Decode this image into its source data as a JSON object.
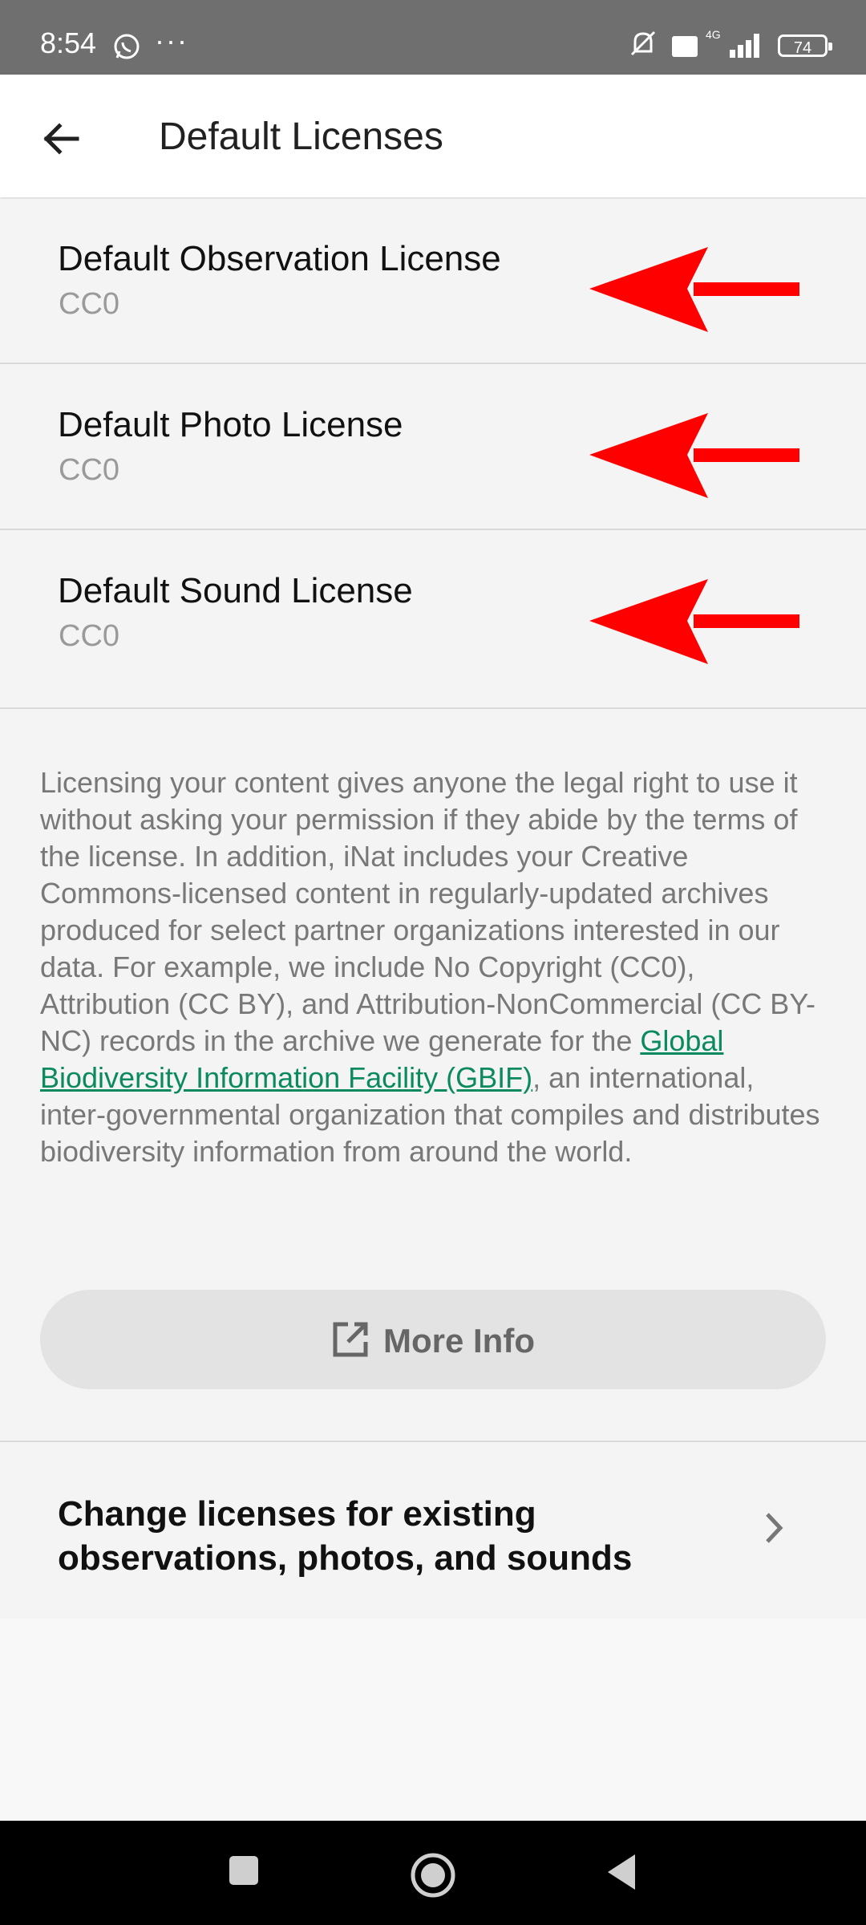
{
  "status_bar": {
    "time": "8:54",
    "dots": "···",
    "volte": "Vo LTE",
    "network": "4G",
    "battery": "74"
  },
  "app_bar": {
    "title": "Default Licenses"
  },
  "licenses": [
    {
      "title": "Default Observation License",
      "value": "CC0"
    },
    {
      "title": "Default Photo License",
      "value": "CC0"
    },
    {
      "title": "Default Sound License",
      "value": "CC0"
    }
  ],
  "info": {
    "text_before_link": "Licensing your content gives anyone the legal right to use it without asking your permission if they abide by the terms of the license. In addition, iNat includes your Creative Commons-licensed content in regularly-updated archives produced for select partner organizations interested in our data. For example, we include No Copyright (CC0), Attribution (CC BY), and Attribution-NonCommercial (CC BY-NC) records in the archive we generate for the ",
    "link_text": "Global Biodiversity Information Facility (GBIF)",
    "text_after_link": ", an international, inter-governmental organization that compiles and distributes biodiversity information from around the world."
  },
  "more_info_button": {
    "label": "More Info"
  },
  "change_licenses": {
    "label": "Change licenses for existing observations, photos, and sounds"
  },
  "colors": {
    "link": "#0b8a5e",
    "annotation_arrow": "#ff0000"
  }
}
